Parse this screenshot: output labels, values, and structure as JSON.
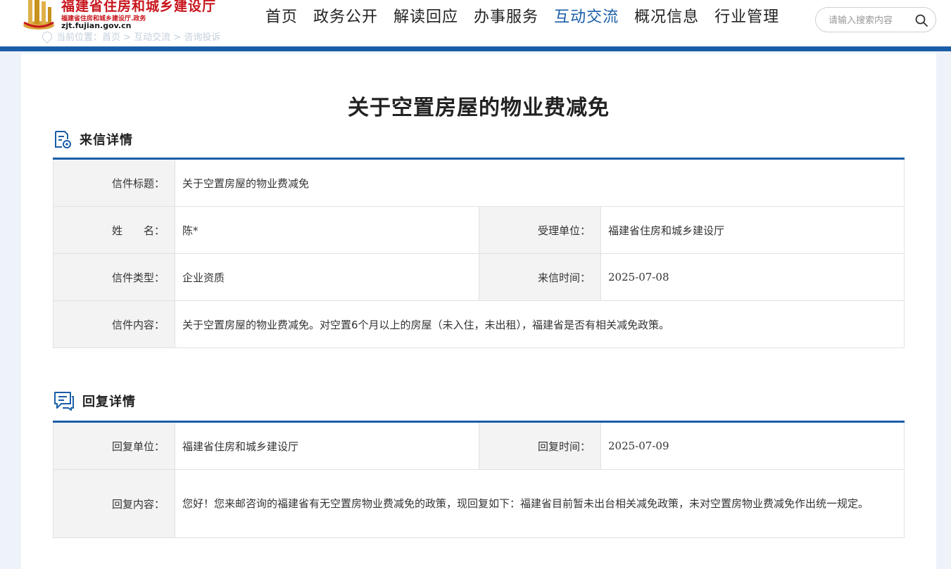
{
  "header": {
    "site_title": "福建省住房和城乡建设厅",
    "site_subtitle": "福建省住房和城乡建设厅.政务",
    "site_url": "zjt.fujian.gov.cn",
    "breadcrumb": "当前位置：首页 > 互动交流 > 咨询投诉",
    "nav": [
      {
        "label": "首页"
      },
      {
        "label": "政务公开"
      },
      {
        "label": "解读回应"
      },
      {
        "label": "办事服务"
      },
      {
        "label": "互动交流"
      },
      {
        "label": "概况信息"
      },
      {
        "label": "行业管理"
      }
    ],
    "active_nav": "互动交流",
    "search_placeholder": "请输入搜索内容"
  },
  "page": {
    "title": "关于空置房屋的物业费减免"
  },
  "letter": {
    "section_label": "来信详情",
    "title_key": "信件标题：",
    "title_value": "关于空置房屋的物业费减免",
    "name_key": "姓　　名：",
    "name_value": "陈*",
    "unit_key": "受理单位：",
    "unit_value": "福建省住房和城乡建设厅",
    "type_key": "信件类型：",
    "type_value": "企业资质",
    "time_key": "来信时间：",
    "time_value": "2025-07-08",
    "content_key": "信件内容：",
    "content_value": "关于空置房屋的物业费减免。对空置6个月以上的房屋（未入住，未出租），福建省是否有相关减免政策。"
  },
  "reply": {
    "section_label": "回复详情",
    "unit_key": "回复单位：",
    "unit_value": "福建省住房和城乡建设厅",
    "time_key": "回复时间：",
    "time_value": "2025-07-09",
    "content_key": "回复内容：",
    "content_value": "您好！您来邮咨询的福建省有无空置房物业费减免的政策，现回复如下：福建省目前暂未出台相关减免政策，未对空置房物业费减免作出统一规定。"
  },
  "colors": {
    "brand_blue": "#1a5ea8",
    "brand_red": "#c8161d"
  }
}
